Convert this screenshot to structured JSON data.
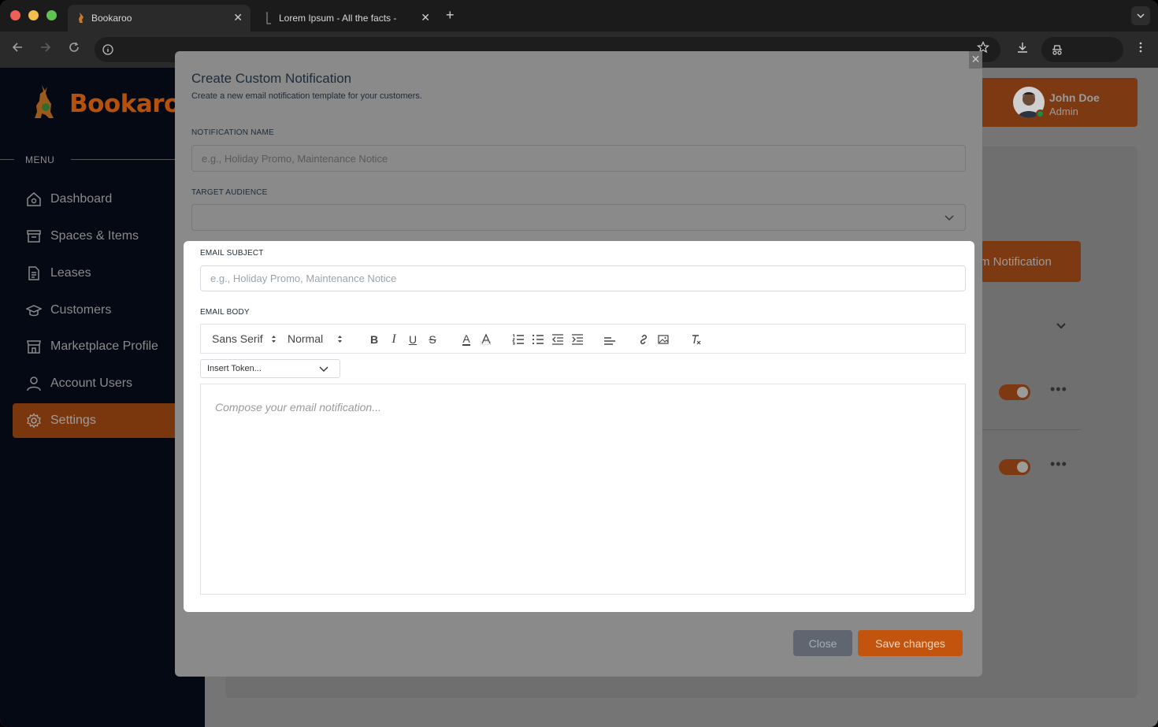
{
  "browser": {
    "tabs": [
      {
        "title": "Bookaroo",
        "active": true
      },
      {
        "title": "Lorem Ipsum - All the facts - ",
        "active": false
      }
    ],
    "new_tab": "+",
    "close_glyph": "✕"
  },
  "sidebar": {
    "brand": "Bookaroo",
    "menu_label": "MENU",
    "items": [
      {
        "label": "Dashboard",
        "icon": "home-icon"
      },
      {
        "label": "Spaces & Items",
        "icon": "archive-icon"
      },
      {
        "label": "Leases",
        "icon": "document-icon"
      },
      {
        "label": "Customers",
        "icon": "graduation-cap-icon"
      },
      {
        "label": "Marketplace Profile",
        "icon": "store-icon"
      },
      {
        "label": "Account Users",
        "icon": "user-icon"
      },
      {
        "label": "Settings",
        "icon": "gear-icon",
        "active": true
      }
    ]
  },
  "header": {
    "user_name": "John Doe",
    "user_role": "Admin"
  },
  "background_page": {
    "custom_button_label": "m Notification"
  },
  "modal": {
    "title": "Create Custom Notification",
    "subtitle": "Create a new email notification template for your customers.",
    "name_label": "NOTIFICATION NAME",
    "name_placeholder": "e.g., Holiday Promo, Maintenance Notice",
    "audience_label": "TARGET AUDIENCE",
    "audience_value": "",
    "subject_label": "EMAIL SUBJECT",
    "subject_placeholder": "e.g., Holiday Promo, Maintenance Notice",
    "body_label": "EMAIL BODY",
    "font_select": "Sans Serif",
    "size_select": "Normal",
    "token_select": "Insert Token...",
    "body_placeholder": "Compose your email notification...",
    "close_label": "Close",
    "save_label": "Save changes"
  },
  "colors": {
    "brand_orange": "#c2540d",
    "sidebar_bg": "#050913",
    "title_text": "#1e2b38"
  }
}
